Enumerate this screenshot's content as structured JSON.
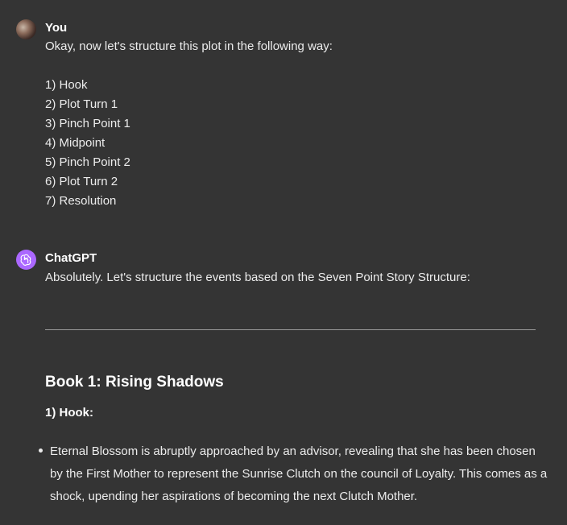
{
  "user_message": {
    "author": "You",
    "text": "Okay, now let's structure this plot in the following way:",
    "items": [
      "1) Hook",
      "2) Plot Turn 1",
      "3) Pinch Point 1",
      "4) Midpoint",
      "5) Pinch Point 2",
      "6) Plot Turn 2",
      "7) Resolution"
    ]
  },
  "assistant_message": {
    "author": "ChatGPT",
    "intro": "Absolutely. Let's structure the events based on the Seven Point Story Structure:",
    "book_title": "Book 1: Rising Shadows",
    "section_heading": "1) Hook:",
    "bullets": [
      "Eternal Blossom is abruptly approached by an advisor, revealing that she has been chosen by the First Mother to represent the Sunrise Clutch on the council of Loyalty. This comes as a shock, upending her aspirations of becoming the next Clutch Mother."
    ]
  },
  "colors": {
    "background": "#343434",
    "text": "#ececec",
    "heading": "#ffffff",
    "gpt_avatar": "#ab68ff"
  },
  "icons": {
    "user_avatar": "user-photo",
    "gpt_avatar": "openai-logo-icon"
  }
}
